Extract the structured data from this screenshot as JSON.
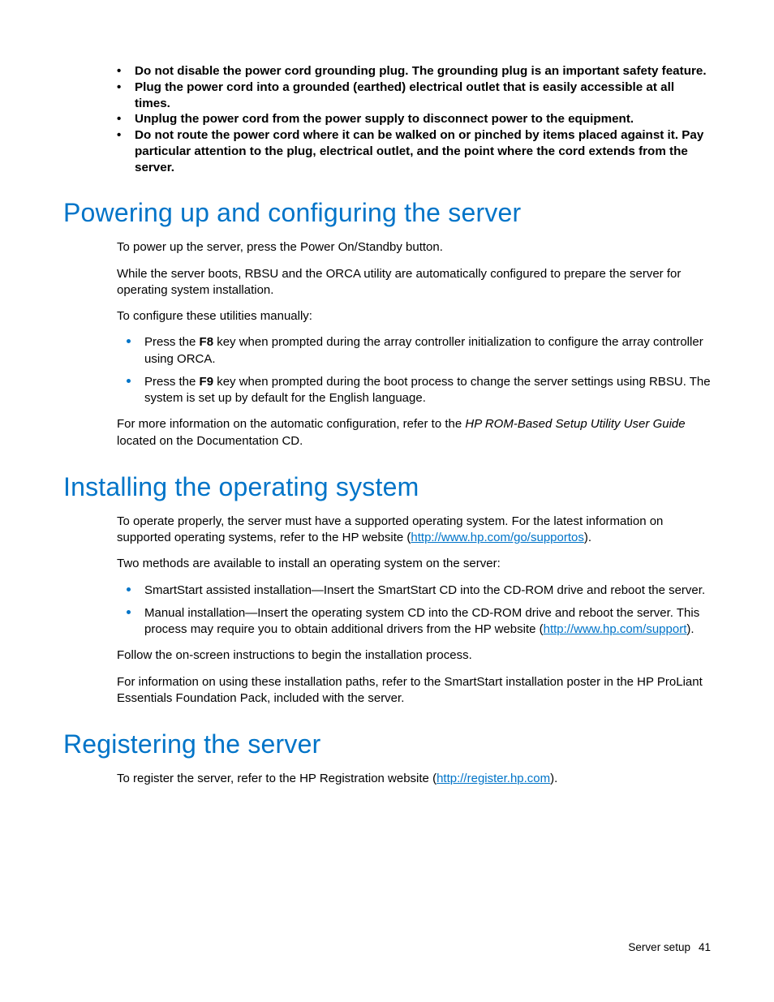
{
  "safety_bullets": [
    "Do not disable the power cord grounding plug. The grounding plug is an important safety feature.",
    "Plug the power cord into a grounded (earthed) electrical outlet that is easily accessible at all times.",
    "Unplug the power cord from the power supply to disconnect power to the equipment.",
    "Do not route the power cord where it can be walked on or pinched by items placed against it. Pay particular attention to the plug, electrical outlet, and the point where the cord extends from the server."
  ],
  "sections": {
    "powering": {
      "heading": "Powering up and configuring the server",
      "p1": "To power up the server, press the Power On/Standby button.",
      "p2": "While the server boots, RBSU and the ORCA utility are automatically configured to prepare the server for operating system installation.",
      "p3": "To configure these utilities manually:",
      "li1_a": "Press the ",
      "li1_key": "F8",
      "li1_b": " key when prompted during the array controller initialization to configure the array controller using ORCA.",
      "li2_a": "Press the ",
      "li2_key": "F9",
      "li2_b": " key when prompted during the boot process to change the server settings using RBSU. The system is set up by default for the English language.",
      "p4_a": "For more information on the automatic configuration, refer to the ",
      "p4_i": "HP ROM-Based Setup Utility User Guide",
      "p4_b": " located on the Documentation CD."
    },
    "installing": {
      "heading": "Installing the operating system",
      "p1_a": "To operate properly, the server must have a supported operating system. For the latest information on supported operating systems, refer to the HP website (",
      "p1_link": "http://www.hp.com/go/supportos",
      "p1_b": ").",
      "p2": "Two methods are available to install an operating system on the server:",
      "li1": "SmartStart assisted installation—Insert the SmartStart CD into the CD-ROM drive and reboot the server.",
      "li2_a": "Manual installation—Insert the operating system CD into the CD-ROM drive and reboot the server. This process may require you to obtain additional drivers from the HP website (",
      "li2_link": "http://www.hp.com/support",
      "li2_b": ").",
      "p3": "Follow the on-screen instructions to begin the installation process.",
      "p4": "For information on using these installation paths, refer to the SmartStart installation poster in the HP ProLiant Essentials Foundation Pack, included with the server."
    },
    "registering": {
      "heading": "Registering the server",
      "p1_a": "To register the server, refer to the HP Registration website (",
      "p1_link": "http://register.hp.com",
      "p1_b": ")."
    }
  },
  "footer": {
    "section": "Server setup",
    "page": "41"
  }
}
